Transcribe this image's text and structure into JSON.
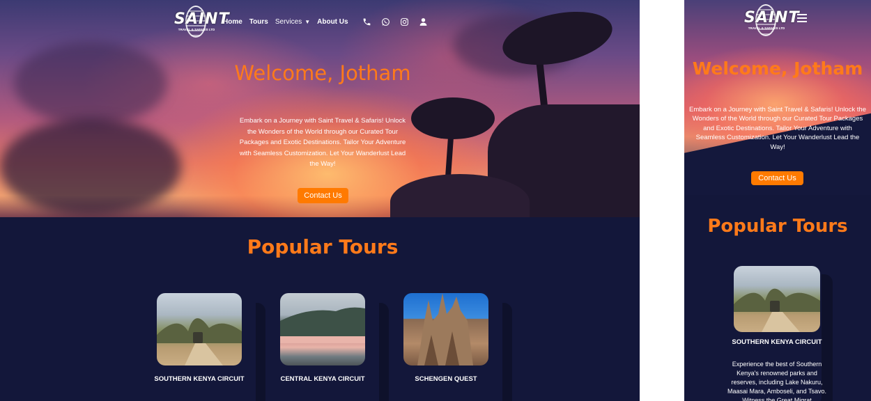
{
  "site": {
    "logo_text": "SAINT",
    "logo_sub": "TRAVEL & SAFARIS LTD"
  },
  "nav": {
    "items": [
      {
        "label": "Home"
      },
      {
        "label": "Tours"
      },
      {
        "label": "Services"
      },
      {
        "label": "About Us"
      }
    ],
    "icons": [
      "phone-icon",
      "whatsapp-icon",
      "instagram-icon",
      "user-icon"
    ]
  },
  "hero": {
    "title": "Welcome, Jotham",
    "text": "Embark on a Journey with Saint Travel & Safaris! Unlock the Wonders of the World through our Curated Tour Packages and Exotic Destinations. Tailor Your Adventure with Seamless Customization. Let Your Wanderlust Lead the Way!",
    "button": "Contact Us"
  },
  "tours": {
    "title": "Popular Tours",
    "cards": [
      {
        "name": "SOUTHERN KENYA CIRCUIT",
        "desc": "Experience the best of Southern Kenya's renowned parks and reserves, including Lake Nakuru, Maasai Mara, Amboseli, and Tsavo. Witness the Great Migrat"
      },
      {
        "name": "CENTRAL KENYA CIRCUIT",
        "desc": ""
      },
      {
        "name": "SCHENGEN QUEST",
        "desc": ""
      }
    ]
  },
  "colors": {
    "accent": "#ff7a1a",
    "button": "#ff7a00",
    "section_bg": "#13173a"
  }
}
